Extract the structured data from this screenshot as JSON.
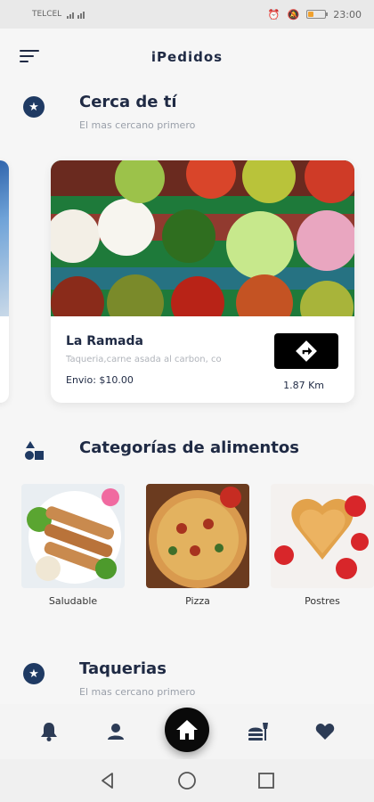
{
  "status_bar": {
    "carrier": "TELCEL",
    "time": "23:00"
  },
  "app_bar": {
    "title": "iPedidos",
    "menu_icon": "menu-icon"
  },
  "nearby_section": {
    "title": "Cerca de tí",
    "subtitle": "El mas cercano primero",
    "icon": "star-icon"
  },
  "restaurant_card": {
    "name": "La Ramada",
    "description": "Taqueria,carne asada al carbon, co",
    "fee": "Envio: $10.00",
    "distance": "1.87 Km",
    "directions_icon": "directions-icon"
  },
  "categories_section": {
    "title": "Categorías de alimentos",
    "icon": "shapes-icon",
    "items": [
      {
        "label": "Saludable"
      },
      {
        "label": "Pizza"
      },
      {
        "label": "Postres"
      }
    ]
  },
  "taquerias_section": {
    "title": "Taquerias",
    "subtitle": "El mas cercano primero",
    "icon": "star-icon"
  },
  "bottom_nav": {
    "items": [
      "bell-icon",
      "user-icon",
      "home-icon",
      "food-icon",
      "heart-icon"
    ],
    "active": "home-icon",
    "accent": "#0a0a0a"
  },
  "colors": {
    "primary_text": "#1f2a44",
    "icon_circle": "#1f3a63",
    "subtitle": "#9aa0aa"
  }
}
